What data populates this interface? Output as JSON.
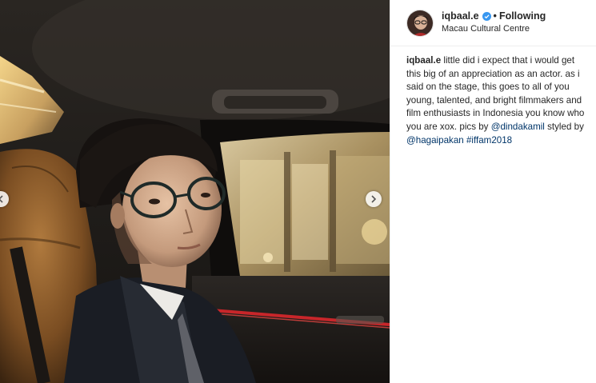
{
  "post": {
    "username": "iqbaal.e",
    "verified_icon": "verified-badge-icon",
    "separator": "•",
    "follow_status": "Following",
    "location": "Macau Cultural Centre"
  },
  "caption": {
    "username": "iqbaal.e",
    "text_1": " little did i expect that i would get this big of an appreciation as an actor. as i said on the stage, this goes to all of you young, talented, and bright filmmakers and film enthusiasts in Indonesia you know who you are xox. pics by ",
    "mention_1": "@dindakamil",
    "text_2": " styled by ",
    "mention_2": "@hagaipakan",
    "text_3": " ",
    "hashtag": "#iffam2018"
  },
  "photo": {
    "icon": "photo-image",
    "prev_icon": "chevron-left-icon",
    "next_icon": "chevron-right-icon"
  },
  "colors": {
    "link": "#003569",
    "verified": "#3897f0",
    "text": "#262626"
  }
}
